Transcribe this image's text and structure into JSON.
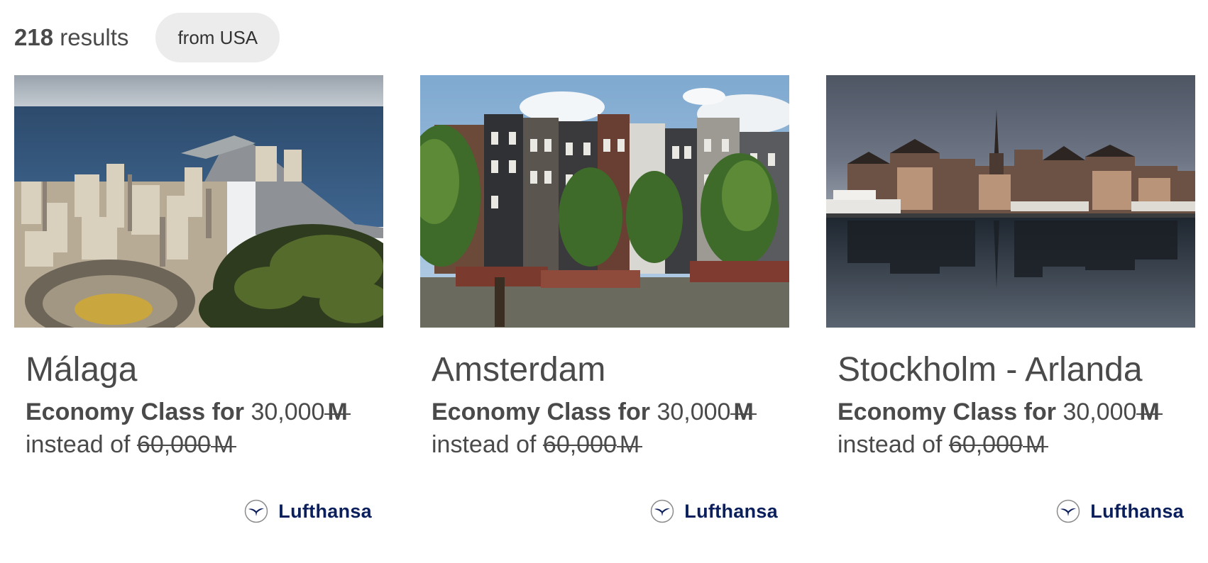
{
  "header": {
    "results_count": "218",
    "results_label": "results",
    "filter_chip": "from USA"
  },
  "offers": [
    {
      "destination": "Málaga",
      "class_label": "Economy Class for",
      "price_miles": "30,000",
      "instead_label": "instead of",
      "original_miles": "60,000",
      "miles_symbol": "M",
      "airline": "Lufthansa"
    },
    {
      "destination": "Amsterdam",
      "class_label": "Economy Class for",
      "price_miles": "30,000",
      "instead_label": "instead of",
      "original_miles": "60,000",
      "miles_symbol": "M",
      "airline": "Lufthansa"
    },
    {
      "destination": "Stockholm - Arlanda",
      "class_label": "Economy Class for",
      "price_miles": "30,000",
      "instead_label": "instead of",
      "original_miles": "60,000",
      "miles_symbol": "M",
      "airline": "Lufthansa"
    }
  ],
  "colors": {
    "text": "#4a4a4a",
    "chip_bg": "#ececec",
    "airline_navy": "#0b1f5c"
  }
}
